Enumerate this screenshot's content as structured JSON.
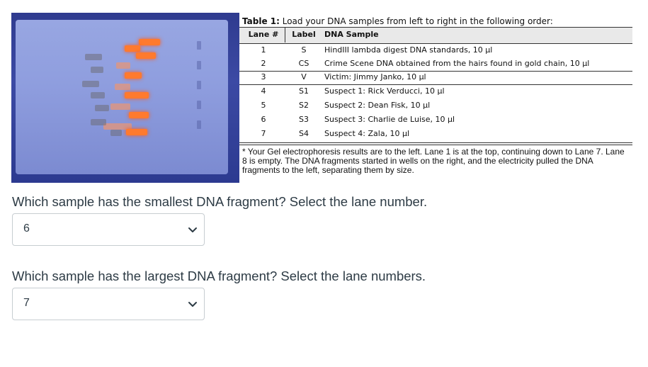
{
  "table": {
    "title_bold": "Table 1:",
    "title_rest": " Load your DNA samples from left to right in the following order:",
    "headers": {
      "lane": "Lane #",
      "label": "Label",
      "sample": "DNA Sample"
    },
    "rows": [
      {
        "lane": "1",
        "label": "S",
        "sample": "HindIII lambda digest DNA standards, 10 µl"
      },
      {
        "lane": "2",
        "label": "CS",
        "sample": "Crime Scene DNA obtained from the hairs found in gold chain, 10 µl"
      },
      {
        "lane": "3",
        "label": "V",
        "sample": "Victim: Jimmy Janko, 10 µl"
      },
      {
        "lane": "4",
        "label": "S1",
        "sample": "Suspect 1: Rick Verducci, 10 µl"
      },
      {
        "lane": "5",
        "label": "S2",
        "sample": "Suspect 2: Dean Fisk, 10 µl"
      },
      {
        "lane": "6",
        "label": "S3",
        "sample": "Suspect 3: Charlie de Luise, 10 µl"
      },
      {
        "lane": "7",
        "label": "S4",
        "sample": "Suspect 4: Zala, 10 µl"
      }
    ],
    "footnote": "* Your Gel electrophoresis results are to the left.  Lane 1 is at the top, continuing down to Lane 7.  Lane 8 is empty. The DNA fragments started in wells on the right, and the electricity pulled the DNA fragments to the left, separating them by size."
  },
  "questions": [
    {
      "text": "Which sample has the smallest DNA fragment? Select the lane number.",
      "selected": "6"
    },
    {
      "text": "Which sample has the largest DNA fragment? Select the lane numbers.",
      "selected": "7"
    }
  ],
  "icons": {
    "dropdown": "chevron-down-icon"
  },
  "colors": {
    "question_text": "#2d3b45",
    "select_border": "#c7cdd1",
    "gel_band": "#ff7a2e"
  }
}
